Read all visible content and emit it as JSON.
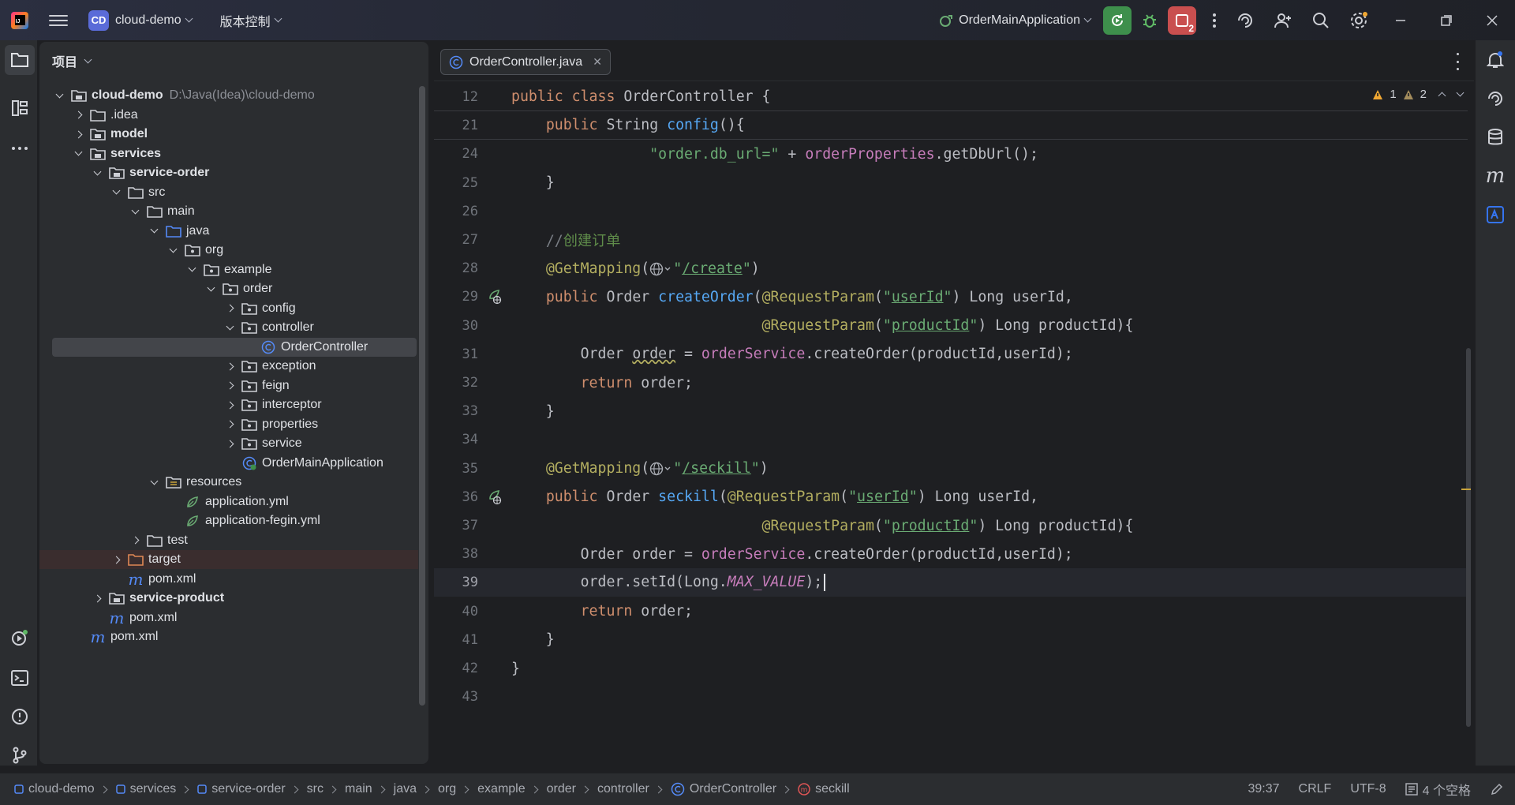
{
  "titlebar": {
    "project_badge": "CD",
    "project_name": "cloud-demo",
    "vcs_menu": "版本控制",
    "run_config": "OrderMainApplication",
    "stop_badge": "2"
  },
  "project_panel": {
    "title": "项目",
    "tree": [
      {
        "label": "cloud-demo",
        "path": "D:\\Java(Idea)\\cloud-demo",
        "depth": 0,
        "arrow": "down",
        "icon": "module-folder-icon",
        "bold": true
      },
      {
        "label": ".idea",
        "depth": 1,
        "arrow": "right",
        "icon": "folder-icon"
      },
      {
        "label": "model",
        "depth": 1,
        "arrow": "right",
        "icon": "module-folder-icon",
        "bold": true
      },
      {
        "label": "services",
        "depth": 1,
        "arrow": "down",
        "icon": "module-folder-icon",
        "bold": true
      },
      {
        "label": "service-order",
        "depth": 2,
        "arrow": "down",
        "icon": "module-folder-icon",
        "bold": true
      },
      {
        "label": "src",
        "depth": 3,
        "arrow": "down",
        "icon": "folder-icon"
      },
      {
        "label": "main",
        "depth": 4,
        "arrow": "down",
        "icon": "folder-icon"
      },
      {
        "label": "java",
        "depth": 5,
        "arrow": "down",
        "icon": "source-folder-icon"
      },
      {
        "label": "org",
        "depth": 6,
        "arrow": "down",
        "icon": "package-icon"
      },
      {
        "label": "example",
        "depth": 7,
        "arrow": "down",
        "icon": "package-icon"
      },
      {
        "label": "order",
        "depth": 8,
        "arrow": "down",
        "icon": "package-icon"
      },
      {
        "label": "config",
        "depth": 9,
        "arrow": "right",
        "icon": "package-icon"
      },
      {
        "label": "controller",
        "depth": 9,
        "arrow": "down",
        "icon": "package-icon"
      },
      {
        "label": "OrderController",
        "depth": 10,
        "arrow": "none",
        "icon": "java-class-icon",
        "selected": true
      },
      {
        "label": "exception",
        "depth": 9,
        "arrow": "right",
        "icon": "package-icon"
      },
      {
        "label": "feign",
        "depth": 9,
        "arrow": "right",
        "icon": "package-icon"
      },
      {
        "label": "interceptor",
        "depth": 9,
        "arrow": "right",
        "icon": "package-icon"
      },
      {
        "label": "properties",
        "depth": 9,
        "arrow": "right",
        "icon": "package-icon"
      },
      {
        "label": "service",
        "depth": 9,
        "arrow": "right",
        "icon": "package-icon"
      },
      {
        "label": "OrderMainApplication",
        "depth": 9,
        "arrow": "none",
        "icon": "spring-boot-class-icon"
      },
      {
        "label": "resources",
        "depth": 5,
        "arrow": "down",
        "icon": "resources-folder-icon"
      },
      {
        "label": "application.yml",
        "depth": 6,
        "arrow": "none",
        "icon": "spring-yaml-icon"
      },
      {
        "label": "application-fegin.yml",
        "depth": 6,
        "arrow": "none",
        "icon": "spring-yaml-icon"
      },
      {
        "label": "test",
        "depth": 4,
        "arrow": "right",
        "icon": "folder-icon"
      },
      {
        "label": "target",
        "depth": 3,
        "arrow": "right",
        "icon": "excluded-folder-icon",
        "target": true
      },
      {
        "label": "pom.xml",
        "depth": 3,
        "arrow": "none",
        "icon": "maven-icon"
      },
      {
        "label": "service-product",
        "depth": 2,
        "arrow": "right",
        "icon": "module-folder-icon",
        "bold": true
      },
      {
        "label": "pom.xml",
        "depth": 2,
        "arrow": "none",
        "icon": "maven-icon"
      },
      {
        "label": "pom.xml",
        "depth": 1,
        "arrow": "none",
        "icon": "maven-icon"
      }
    ]
  },
  "editor": {
    "tab_label": "OrderController.java",
    "inspections": {
      "warnings": "1",
      "weak_warnings": "2"
    },
    "lines": [
      {
        "n": "12",
        "sticky": true,
        "tokens": [
          [
            "kw",
            "public class "
          ],
          [
            "",
            "OrderController {"
          ]
        ]
      },
      {
        "n": "21",
        "sticky": true,
        "tokens": [
          [
            "",
            "    "
          ],
          [
            "kw",
            "public "
          ],
          [
            "",
            "String "
          ],
          [
            "fn",
            "config"
          ],
          [
            "",
            "(){"
          ]
        ]
      },
      {
        "n": "24",
        "tokens": [
          [
            "",
            "                "
          ],
          [
            "str",
            "\"order.db_url=\""
          ],
          [
            "",
            " + "
          ],
          [
            "fld",
            "orderProperties"
          ],
          [
            "",
            ".getDbUrl();"
          ]
        ]
      },
      {
        "n": "25",
        "tokens": [
          [
            "",
            "    }"
          ]
        ]
      },
      {
        "n": "26",
        "tokens": []
      },
      {
        "n": "27",
        "tokens": [
          [
            "",
            "    "
          ],
          [
            "cm",
            "//"
          ],
          [
            "cmcn",
            "创建订单"
          ]
        ]
      },
      {
        "n": "28",
        "tokens": [
          [
            "",
            "    "
          ],
          [
            "ann",
            "@GetMapping"
          ],
          [
            "",
            "("
          ],
          [
            "globe",
            ""
          ],
          [
            "str",
            "\""
          ],
          [
            "str und",
            "/create"
          ],
          [
            "str",
            "\""
          ],
          [
            "",
            ")"
          ]
        ]
      },
      {
        "n": "29",
        "gutter": "endpoint",
        "tokens": [
          [
            "",
            "    "
          ],
          [
            "kw",
            "public "
          ],
          [
            "",
            "Order "
          ],
          [
            "fn",
            "createOrder"
          ],
          [
            "",
            "("
          ],
          [
            "ann",
            "@RequestParam"
          ],
          [
            "",
            "("
          ],
          [
            "str",
            "\""
          ],
          [
            "str und",
            "userId"
          ],
          [
            "str",
            "\""
          ],
          [
            "",
            ") Long userId,"
          ]
        ]
      },
      {
        "n": "30",
        "tokens": [
          [
            "",
            "                             "
          ],
          [
            "ann",
            "@RequestParam"
          ],
          [
            "",
            "("
          ],
          [
            "str",
            "\""
          ],
          [
            "str und",
            "productId"
          ],
          [
            "str",
            "\""
          ],
          [
            "",
            ") Long productId){"
          ]
        ]
      },
      {
        "n": "31",
        "tokens": [
          [
            "",
            "        Order "
          ],
          [
            "wavy",
            "order"
          ],
          [
            "",
            " = "
          ],
          [
            "fld",
            "orderService"
          ],
          [
            "",
            ".createOrder(productId,userId);"
          ]
        ]
      },
      {
        "n": "32",
        "tokens": [
          [
            "",
            "        "
          ],
          [
            "kw",
            "return "
          ],
          [
            "",
            "order;"
          ]
        ]
      },
      {
        "n": "33",
        "tokens": [
          [
            "",
            "    }"
          ]
        ]
      },
      {
        "n": "34",
        "tokens": []
      },
      {
        "n": "35",
        "tokens": [
          [
            "",
            "    "
          ],
          [
            "ann",
            "@GetMapping"
          ],
          [
            "",
            "("
          ],
          [
            "globe",
            ""
          ],
          [
            "str",
            "\""
          ],
          [
            "str und",
            "/seckill"
          ],
          [
            "str",
            "\""
          ],
          [
            "",
            ")"
          ]
        ]
      },
      {
        "n": "36",
        "gutter": "endpoint",
        "tokens": [
          [
            "",
            "    "
          ],
          [
            "kw",
            "public "
          ],
          [
            "",
            "Order "
          ],
          [
            "fn",
            "seckill"
          ],
          [
            "",
            "("
          ],
          [
            "ann",
            "@RequestParam"
          ],
          [
            "",
            "("
          ],
          [
            "str",
            "\""
          ],
          [
            "str und",
            "userId"
          ],
          [
            "str",
            "\""
          ],
          [
            "",
            ") Long userId,"
          ]
        ]
      },
      {
        "n": "37",
        "tokens": [
          [
            "",
            "                             "
          ],
          [
            "ann",
            "@RequestParam"
          ],
          [
            "",
            "("
          ],
          [
            "str",
            "\""
          ],
          [
            "str und",
            "productId"
          ],
          [
            "str",
            "\""
          ],
          [
            "",
            ") Long productId){"
          ]
        ]
      },
      {
        "n": "38",
        "tokens": [
          [
            "",
            "        Order order = "
          ],
          [
            "fld",
            "orderService"
          ],
          [
            "",
            ".createOrder(productId,userId);"
          ]
        ]
      },
      {
        "n": "39",
        "current": true,
        "tokens": [
          [
            "",
            "        order.setId(Long."
          ],
          [
            "fld italic",
            "MAX_VALUE"
          ],
          [
            "",
            ");"
          ],
          [
            "caret",
            ""
          ]
        ]
      },
      {
        "n": "40",
        "tokens": [
          [
            "",
            "        "
          ],
          [
            "kw",
            "return "
          ],
          [
            "",
            "order;"
          ]
        ]
      },
      {
        "n": "41",
        "tokens": [
          [
            "",
            "    }"
          ]
        ]
      },
      {
        "n": "42",
        "tokens": [
          [
            "",
            "}"
          ]
        ]
      },
      {
        "n": "43",
        "tokens": []
      }
    ]
  },
  "statusbar": {
    "breadcrumbs": [
      {
        "label": "cloud-demo",
        "icon": "module-icon"
      },
      {
        "label": "services",
        "icon": "module-icon"
      },
      {
        "label": "service-order",
        "icon": "module-icon"
      },
      {
        "label": "src",
        "icon": ""
      },
      {
        "label": "main",
        "icon": ""
      },
      {
        "label": "java",
        "icon": ""
      },
      {
        "label": "org",
        "icon": ""
      },
      {
        "label": "example",
        "icon": ""
      },
      {
        "label": "order",
        "icon": ""
      },
      {
        "label": "controller",
        "icon": ""
      },
      {
        "label": "OrderController",
        "icon": "java-class-icon"
      },
      {
        "label": "seckill",
        "icon": "method-icon"
      }
    ],
    "position": "39:37",
    "line_sep": "CRLF",
    "encoding": "UTF-8",
    "indent": "4 个空格"
  },
  "colors": {
    "accent": "#3574f0",
    "run_green": "#3e8f4c",
    "stop_red": "#c94f4f"
  }
}
